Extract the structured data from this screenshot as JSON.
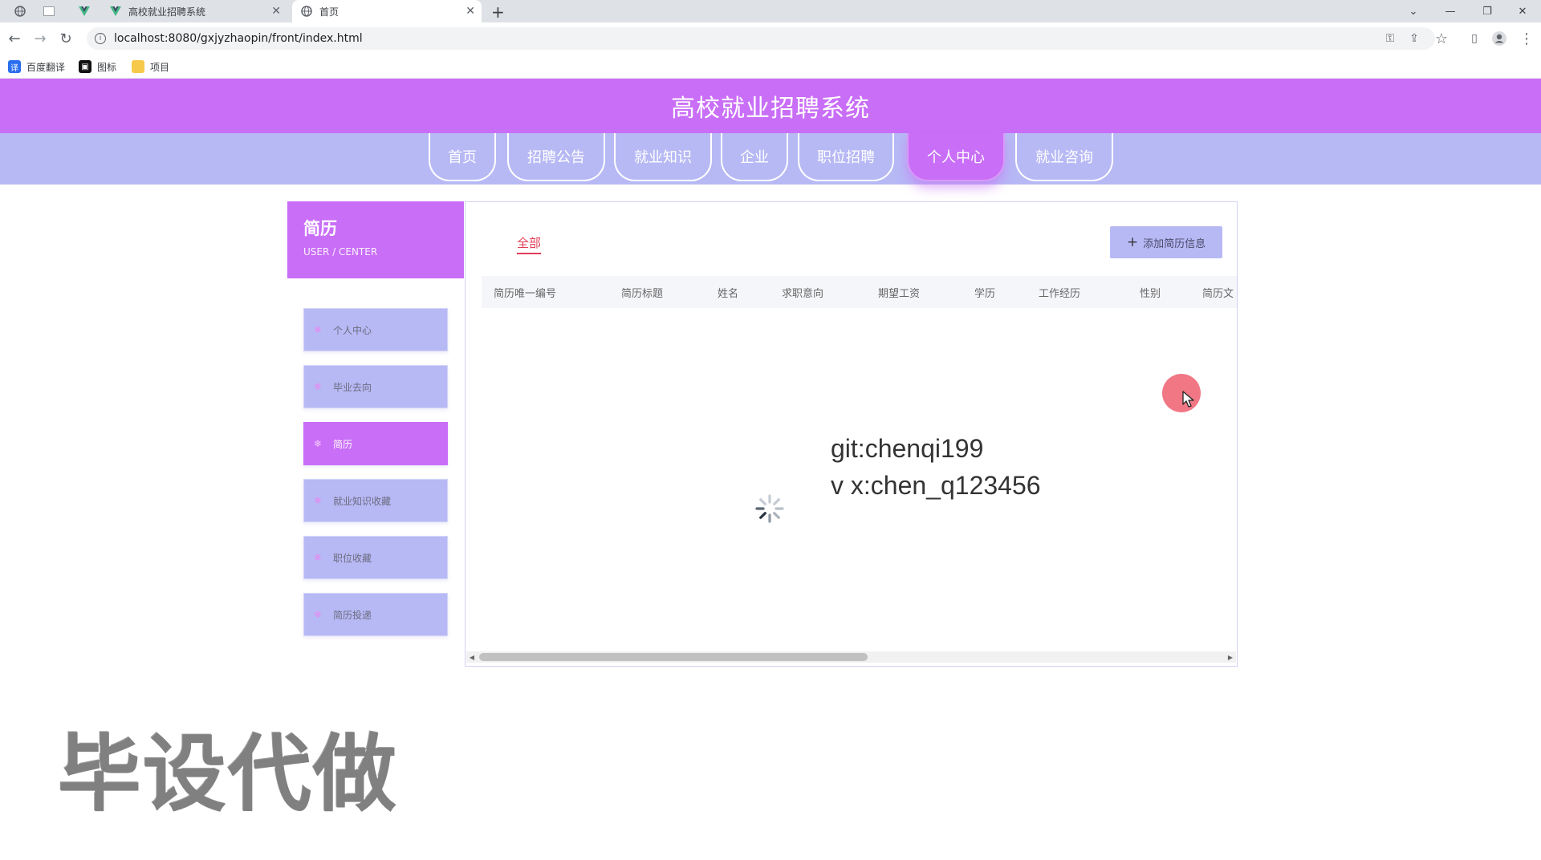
{
  "browser": {
    "tabs": [
      {
        "label": "",
        "icon": "globe-icon"
      },
      {
        "label": "",
        "icon": "blank-page-icon"
      },
      {
        "label": "",
        "icon": "vue-icon"
      },
      {
        "label": "高校就业招聘系统",
        "icon": "vue-icon"
      },
      {
        "label": "首页",
        "icon": "globe-icon"
      }
    ],
    "url": "localhost:8080/gxjyzhaopin/front/index.html",
    "bookmarks": [
      {
        "label": "百度翻译",
        "icon": "translate-icon"
      },
      {
        "label": "图标",
        "icon": "image-icon"
      },
      {
        "label": "项目",
        "icon": "folder-icon"
      }
    ]
  },
  "site": {
    "title": "高校就业招聘系统",
    "nav": [
      "首页",
      "招聘公告",
      "就业知识",
      "企业",
      "职位招聘",
      "个人中心",
      "就业咨询"
    ],
    "active_nav": "个人中心"
  },
  "sidebar": {
    "title": "简历",
    "subtitle": "USER / CENTER",
    "items": [
      "个人中心",
      "毕业去向",
      "简历",
      "就业知识收藏",
      "职位收藏",
      "简历投递"
    ],
    "active_item": "简历"
  },
  "main": {
    "filter_tab": "全部",
    "add_button": "添加简历信息",
    "columns": [
      "简历唯一编号",
      "简历标题",
      "姓名",
      "求职意向",
      "期望工资",
      "学历",
      "工作经历",
      "性别",
      "简历文"
    ],
    "loading": true
  },
  "overlay": {
    "contact_line1": "git:chenqi199",
    "contact_line2": "v x:chen_q123456",
    "watermark": "毕设代做"
  },
  "colors": {
    "header": "#c96ef7",
    "nav": "#b7b9f5",
    "accent_red": "#e23e57"
  }
}
